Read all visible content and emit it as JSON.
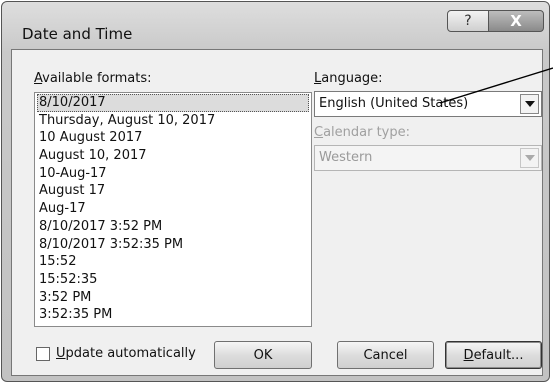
{
  "window": {
    "title": "Date and Time",
    "help_glyph": "?",
    "close_glyph": "X"
  },
  "formats": {
    "label_accel": "A",
    "label_rest": "vailable formats:",
    "items": [
      "8/10/2017",
      "Thursday, August 10, 2017",
      "10 August 2017",
      "August 10, 2017",
      "10-Aug-17",
      "August 17",
      "Aug-17",
      "8/10/2017 3:52 PM",
      "8/10/2017 3:52:35 PM",
      "15:52",
      "15:52:35",
      "3:52 PM",
      "3:52:35 PM"
    ],
    "selected_index": 0
  },
  "language": {
    "label_accel": "L",
    "label_rest": "anguage:",
    "value": "English (United States)"
  },
  "calendar": {
    "label_accel": "C",
    "label_rest": "alendar type:",
    "value": "Western",
    "disabled": true
  },
  "update": {
    "label_accel": "U",
    "label_rest": "pdate automatically",
    "checked": false
  },
  "buttons": {
    "ok": "OK",
    "cancel": "Cancel",
    "default_accel": "D",
    "default_rest": "efault..."
  }
}
